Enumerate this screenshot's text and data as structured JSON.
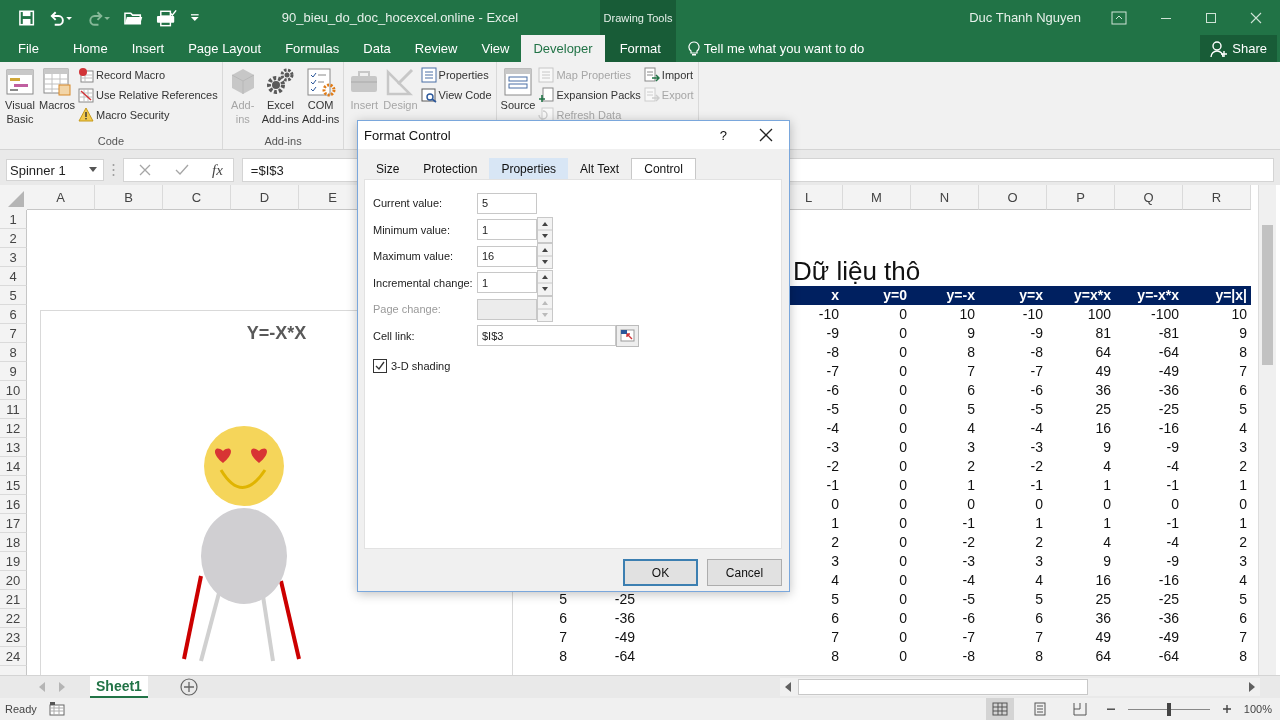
{
  "title_bar": {
    "quick_access": [
      {
        "kind": "save",
        "disabled": false
      },
      {
        "kind": "undo",
        "disabled": false
      },
      {
        "kind": "redo",
        "disabled": true
      },
      {
        "kind": "open",
        "disabled": false
      },
      {
        "kind": "print",
        "disabled": false
      },
      {
        "kind": "customize",
        "disabled": false
      }
    ],
    "title": "90_bieu_do_doc_hocexcel.online - Excel",
    "context_label": "Drawing Tools",
    "user": "Duc Thanh Nguyen"
  },
  "ribbon_tabs": [
    {
      "label": "File",
      "kind": "file",
      "selected": false
    },
    {
      "label": "Home",
      "kind": "normal",
      "selected": false
    },
    {
      "label": "Insert",
      "kind": "normal",
      "selected": false
    },
    {
      "label": "Page Layout",
      "kind": "normal",
      "selected": false
    },
    {
      "label": "Formulas",
      "kind": "normal",
      "selected": false
    },
    {
      "label": "Data",
      "kind": "normal",
      "selected": false
    },
    {
      "label": "Review",
      "kind": "normal",
      "selected": false
    },
    {
      "label": "View",
      "kind": "normal",
      "selected": false
    },
    {
      "label": "Developer",
      "kind": "normal",
      "selected": true
    },
    {
      "label": "Format",
      "kind": "contextual",
      "selected": false
    }
  ],
  "tell_me": "Tell me what you want to do",
  "share": "Share",
  "ribbon_groups": [
    {
      "label": "Code",
      "columns": [
        {
          "kind": "large",
          "items": [
            {
              "kind": "vba",
              "label": "Visual\nBasic",
              "disabled": false
            }
          ]
        },
        {
          "kind": "large",
          "items": [
            {
              "kind": "macros",
              "label": "Macros",
              "disabled": false
            }
          ]
        },
        {
          "kind": "small",
          "items": [
            {
              "kind": "record",
              "label": "Record Macro",
              "disabled": false
            },
            {
              "kind": "relative",
              "label": "Use Relative References",
              "disabled": false
            },
            {
              "kind": "security",
              "label": "Macro Security",
              "disabled": false
            }
          ]
        }
      ]
    },
    {
      "label": "Add-ins",
      "columns": [
        {
          "kind": "large",
          "items": [
            {
              "kind": "addins",
              "label": "Add-\nins",
              "disabled": true
            }
          ]
        },
        {
          "kind": "large",
          "items": [
            {
              "kind": "excel_addins",
              "label": "Excel\nAdd-ins",
              "disabled": false
            }
          ]
        },
        {
          "kind": "large",
          "items": [
            {
              "kind": "com_addins",
              "label": "COM\nAdd-ins",
              "disabled": false
            }
          ]
        }
      ]
    },
    {
      "columns": [
        {
          "kind": "large",
          "items": [
            {
              "kind": "insert",
              "label": "Insert",
              "disabled": true
            }
          ]
        },
        {
          "kind": "large",
          "items": [
            {
              "kind": "design",
              "label": "Design",
              "disabled": true
            }
          ]
        },
        {
          "kind": "small",
          "items": [
            {
              "kind": "properties",
              "label": "Properties",
              "disabled": false
            },
            {
              "kind": "viewcode",
              "label": "View Code",
              "disabled": false
            }
          ]
        }
      ]
    },
    {
      "columns": [
        {
          "kind": "large",
          "items": [
            {
              "kind": "source",
              "label": "Source",
              "disabled": false
            }
          ]
        },
        {
          "kind": "small",
          "items": [
            {
              "kind": "mapprops",
              "label": "Map Properties",
              "disabled": true
            },
            {
              "kind": "expansion",
              "label": "Expansion Packs",
              "disabled": false
            },
            {
              "kind": "refresh",
              "label": "Refresh Data",
              "disabled": true
            }
          ]
        },
        {
          "kind": "small",
          "items": [
            {
              "kind": "import",
              "label": "Import",
              "disabled": false
            },
            {
              "kind": "export",
              "label": "Export",
              "disabled": true
            }
          ]
        }
      ]
    }
  ],
  "formula_bar": {
    "name_box": "Spinner 1",
    "fx": "fx",
    "formula": "=$I$3"
  },
  "sheet": {
    "columns_left": [
      "A",
      "B",
      "C",
      "D",
      "E"
    ],
    "columns_right": [
      "L",
      "M",
      "N",
      "O",
      "P",
      "Q",
      "R"
    ],
    "row_numbers": [
      "1",
      "2",
      "3",
      "4",
      "5",
      "6",
      "7",
      "8",
      "9",
      "10",
      "11",
      "12",
      "13",
      "14",
      "15",
      "16",
      "17",
      "18",
      "19",
      "20",
      "21",
      "22",
      "23",
      "24"
    ],
    "chart": {
      "title": "Y=-X*X"
    },
    "data_table": {
      "title": "Dữ liệu thô",
      "columns": [
        "x",
        "y=0",
        "y=-x",
        "y=x",
        "y=x*x",
        "y=-x*x",
        "y=|x|"
      ],
      "rows": [
        [
          "-10",
          "0",
          "10",
          "-10",
          "100",
          "-100",
          "10"
        ],
        [
          "-9",
          "0",
          "9",
          "-9",
          "81",
          "-81",
          "9"
        ],
        [
          "-8",
          "0",
          "8",
          "-8",
          "64",
          "-64",
          "8"
        ],
        [
          "-7",
          "0",
          "7",
          "-7",
          "49",
          "-49",
          "7"
        ],
        [
          "-6",
          "0",
          "6",
          "-6",
          "36",
          "-36",
          "6"
        ],
        [
          "-5",
          "0",
          "5",
          "-5",
          "25",
          "-25",
          "5"
        ],
        [
          "-4",
          "0",
          "4",
          "-4",
          "16",
          "-16",
          "4"
        ],
        [
          "-3",
          "0",
          "3",
          "-3",
          "9",
          "-9",
          "3"
        ],
        [
          "-2",
          "0",
          "2",
          "-2",
          "4",
          "-4",
          "2"
        ],
        [
          "-1",
          "0",
          "1",
          "-1",
          "1",
          "-1",
          "1"
        ],
        [
          "0",
          "0",
          "0",
          "0",
          "0",
          "0",
          "0"
        ],
        [
          "1",
          "0",
          "-1",
          "1",
          "1",
          "-1",
          "1"
        ],
        [
          "2",
          "0",
          "-2",
          "2",
          "4",
          "-4",
          "2"
        ],
        [
          "3",
          "0",
          "-3",
          "3",
          "9",
          "-9",
          "3"
        ],
        [
          "4",
          "0",
          "-4",
          "4",
          "16",
          "-16",
          "4"
        ],
        [
          "5",
          "0",
          "-5",
          "5",
          "25",
          "-25",
          "5"
        ],
        [
          "6",
          "0",
          "-6",
          "6",
          "36",
          "-36",
          "6"
        ],
        [
          "7",
          "0",
          "-7",
          "7",
          "49",
          "-49",
          "7"
        ],
        [
          "8",
          "0",
          "-8",
          "8",
          "64",
          "-64",
          "8"
        ]
      ]
    },
    "side_values": [
      [
        "5",
        "-25"
      ],
      [
        "6",
        "-36"
      ],
      [
        "7",
        "-49"
      ],
      [
        "8",
        "-64"
      ]
    ]
  },
  "sheet_tabs": [
    {
      "label": "Sheet1",
      "selected": true
    }
  ],
  "status_bar": {
    "text": "Ready",
    "views": [
      {
        "kind": "normal",
        "selected": true
      },
      {
        "kind": "page_layout",
        "selected": false
      },
      {
        "kind": "page_break",
        "selected": false
      }
    ],
    "zoom": {
      "level": 0.5,
      "reading": "100%"
    }
  },
  "dialog": {
    "title": "Format Control",
    "help": "?",
    "tabs": [
      {
        "label": "Size",
        "selected": false,
        "hover": false
      },
      {
        "label": "Protection",
        "selected": false,
        "hover": false
      },
      {
        "label": "Properties",
        "selected": false,
        "hover": true
      },
      {
        "label": "Alt Text",
        "selected": false,
        "hover": false
      },
      {
        "label": "Control",
        "selected": true,
        "hover": false
      }
    ],
    "fields": [
      {
        "label": "Current value:",
        "kind": "text",
        "value": "5",
        "disabled": false
      },
      {
        "label": "Minimum value:",
        "kind": "spin",
        "value": "1",
        "disabled": false
      },
      {
        "label": "Maximum value:",
        "kind": "spin",
        "value": "16",
        "disabled": false
      },
      {
        "label": "Incremental change:",
        "kind": "spin",
        "value": "1",
        "disabled": false
      },
      {
        "label": "Page change:",
        "kind": "spin",
        "disabled": true
      },
      {
        "label": "Cell link:",
        "kind": "reference",
        "value": "$I$3",
        "disabled": false
      }
    ],
    "checkbox": {
      "label": "3-D shading",
      "checked": true
    },
    "buttons": [
      {
        "label": "OK",
        "default": true
      },
      {
        "label": "Cancel",
        "default": false
      }
    ]
  }
}
